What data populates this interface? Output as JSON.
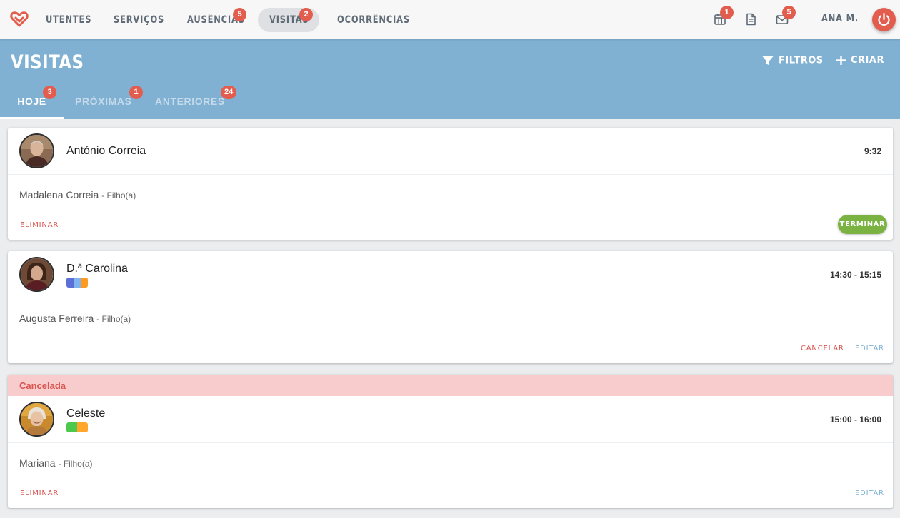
{
  "nav": {
    "items": [
      {
        "label": "UTENTES",
        "badge": ""
      },
      {
        "label": "SERVIÇOS",
        "badge": ""
      },
      {
        "label": "AUSÊNCIAS",
        "badge": "5"
      },
      {
        "label": "VISITAS",
        "badge": "2",
        "active": true
      },
      {
        "label": "OCORRÊNCIAS",
        "badge": ""
      }
    ],
    "tools": [
      {
        "icon": "calendar-icon",
        "badge": "1"
      },
      {
        "icon": "document-icon",
        "badge": ""
      },
      {
        "icon": "envelope-icon",
        "badge": "5"
      }
    ],
    "user": "ANA M.",
    "accent_color": "#e35d4f"
  },
  "header": {
    "title": "VISITAS",
    "filters_label": "FILTROS",
    "create_label": "CRIAR",
    "background_color": "#80b1d3",
    "tabs": [
      {
        "label": "HOJE",
        "badge": "3",
        "active": true
      },
      {
        "label": "PRÓXIMAS",
        "badge": "1"
      },
      {
        "label": "ANTERIORES",
        "badge": "24"
      }
    ]
  },
  "visits": [
    {
      "patient": "António Correia",
      "time": "9:32",
      "visitor": "Madalena Correia",
      "relation": "- Filho(a)",
      "tag_colors": [],
      "actions": {
        "left": "ELIMINAR",
        "right": "TERMINAR"
      }
    },
    {
      "patient": "D.ª Carolina",
      "time": "14:30 - 15:15",
      "visitor": "Augusta Ferreira",
      "relation": "- Filho(a)",
      "tag_colors": [
        "#5b6fd6",
        "#7fb4f0",
        "#ff9a1e"
      ],
      "actions": {
        "cancel": "CANCELAR",
        "edit": "EDITAR"
      }
    },
    {
      "status": "Cancelada",
      "patient": "Celeste",
      "time": "15:00 - 16:00",
      "visitor": "Mariana",
      "relation": "- Filho(a)",
      "tag_colors": [
        "#4cc84c",
        "#ffa62b"
      ],
      "actions": {
        "left": "ELIMINAR",
        "edit": "EDITAR"
      }
    }
  ]
}
